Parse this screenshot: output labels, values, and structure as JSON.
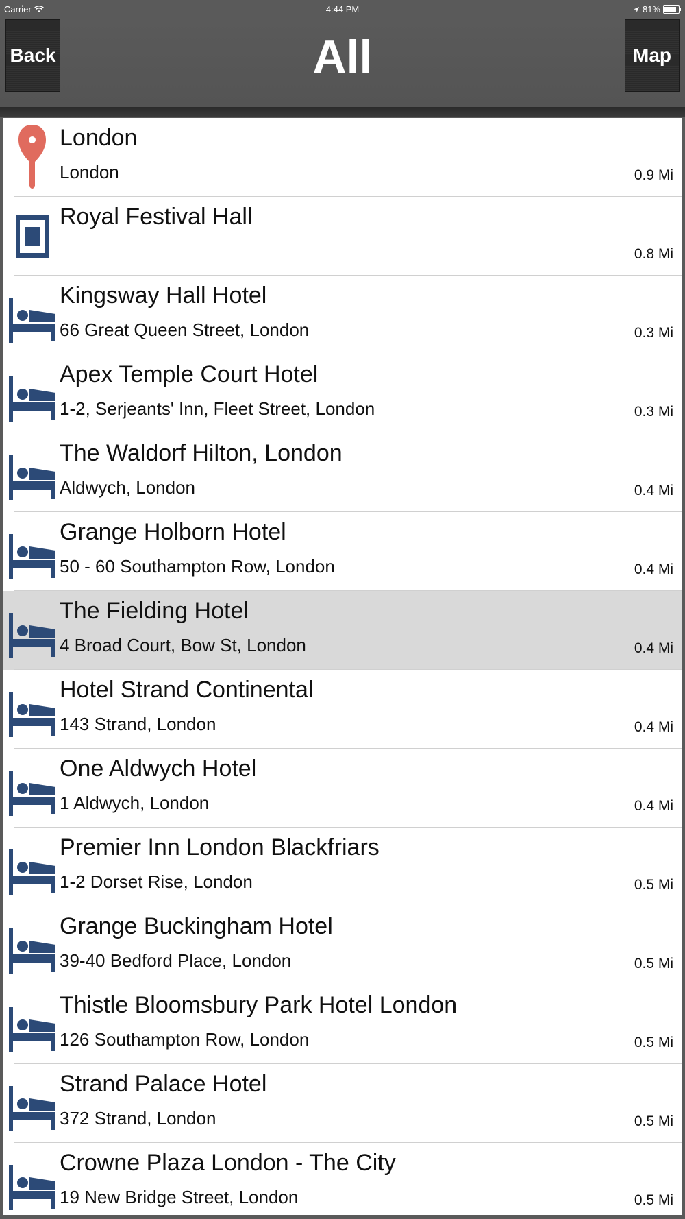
{
  "status_bar": {
    "carrier": "Carrier",
    "time": "4:44 PM",
    "battery": "81%"
  },
  "nav": {
    "title": "All",
    "back_label": "Back",
    "map_label": "Map"
  },
  "colors": {
    "pin": "#e06b5e",
    "hotel_icon": "#2c4a77",
    "selected_row": "#d9d9d9"
  },
  "items": [
    {
      "name": "London",
      "address": "London",
      "distance": "0.9 Mi",
      "icon": "pin-icon"
    },
    {
      "name": "Royal Festival Hall",
      "address": "",
      "distance": "0.8 Mi",
      "icon": "venue-icon"
    },
    {
      "name": "Kingsway Hall Hotel",
      "address": "66 Great Queen Street, London",
      "distance": "0.3 Mi",
      "icon": "bed-icon"
    },
    {
      "name": "Apex Temple Court Hotel",
      "address": "1-2, Serjeants' Inn, Fleet Street, London",
      "distance": "0.3 Mi",
      "icon": "bed-icon"
    },
    {
      "name": "The Waldorf Hilton, London",
      "address": "Aldwych, London",
      "distance": "0.4 Mi",
      "icon": "bed-icon"
    },
    {
      "name": "Grange Holborn Hotel",
      "address": "50 - 60 Southampton Row, London",
      "distance": "0.4 Mi",
      "icon": "bed-icon"
    },
    {
      "name": "The Fielding Hotel",
      "address": "4 Broad Court, Bow St, London",
      "distance": "0.4 Mi",
      "icon": "bed-icon",
      "selected": true
    },
    {
      "name": "Hotel Strand Continental",
      "address": "143 Strand, London",
      "distance": "0.4 Mi",
      "icon": "bed-icon"
    },
    {
      "name": "One Aldwych Hotel",
      "address": "1 Aldwych, London",
      "distance": "0.4 Mi",
      "icon": "bed-icon"
    },
    {
      "name": "Premier Inn London Blackfriars",
      "address": "1-2 Dorset Rise, London",
      "distance": "0.5 Mi",
      "icon": "bed-icon"
    },
    {
      "name": "Grange Buckingham Hotel",
      "address": "39-40 Bedford Place, London",
      "distance": "0.5 Mi",
      "icon": "bed-icon"
    },
    {
      "name": "Thistle Bloomsbury Park Hotel London",
      "address": "126 Southampton Row, London",
      "distance": "0.5 Mi",
      "icon": "bed-icon"
    },
    {
      "name": "Strand Palace Hotel",
      "address": "372 Strand, London",
      "distance": "0.5 Mi",
      "icon": "bed-icon"
    },
    {
      "name": "Crowne Plaza London - The City",
      "address": "19 New Bridge Street, London",
      "distance": "0.5 Mi",
      "icon": "bed-icon"
    }
  ]
}
